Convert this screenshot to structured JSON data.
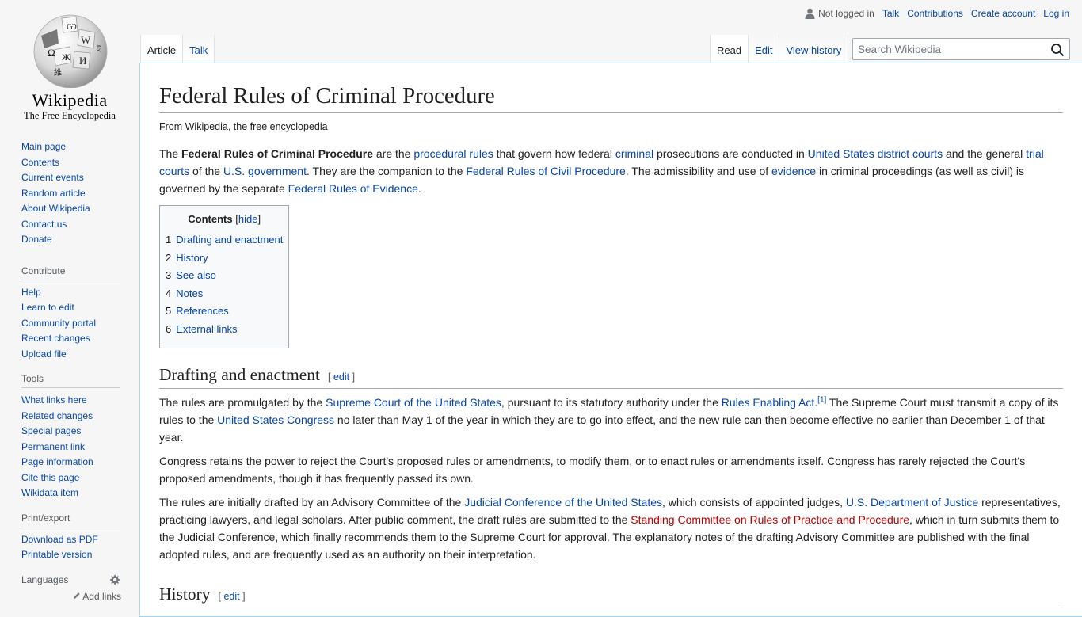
{
  "logo": {
    "wordmark": "Wikipedia",
    "tagline": "The Free Encyclopedia"
  },
  "personal": {
    "not_logged_in": "Not logged in",
    "talk": "Talk",
    "contributions": "Contributions",
    "create_account": "Create account",
    "log_in": "Log in"
  },
  "tabs": {
    "left": [
      "Article",
      "Talk"
    ],
    "right": [
      "Read",
      "Edit",
      "View history"
    ]
  },
  "search": {
    "placeholder": "Search Wikipedia",
    "icon": "search-icon"
  },
  "sidebar": {
    "navigation": [
      "Main page",
      "Contents",
      "Current events",
      "Random article",
      "About Wikipedia",
      "Contact us",
      "Donate"
    ],
    "contribute": {
      "heading": "Contribute",
      "items": [
        "Help",
        "Learn to edit",
        "Community portal",
        "Recent changes",
        "Upload file"
      ]
    },
    "tools": {
      "heading": "Tools",
      "items": [
        "What links here",
        "Related changes",
        "Special pages",
        "Permanent link",
        "Page information",
        "Cite this page",
        "Wikidata item"
      ]
    },
    "printexport": {
      "heading": "Print/export",
      "items": [
        "Download as PDF",
        "Printable version"
      ]
    },
    "languages": {
      "heading": "Languages",
      "add_links": "Add links"
    }
  },
  "article": {
    "title": "Federal Rules of Criminal Procedure",
    "site_sub": "From Wikipedia, the free encyclopedia",
    "intro": {
      "t1": "The ",
      "b1": "Federal Rules of Criminal Procedure",
      "t2": " are the ",
      "l1": "procedural rules",
      "t3": " that govern how federal ",
      "l2": "criminal",
      "t4": " prosecutions are conducted in ",
      "l3": "United States district courts",
      "t5": " and the general ",
      "l4": "trial courts",
      "t6": " of the ",
      "l5": "U.S. government",
      "t7": ". They are the companion to the ",
      "l6": "Federal Rules of Civil Procedure",
      "t8": ". The admissibility and use of ",
      "l7": "evidence",
      "t9": " in criminal proceedings (as well as civil) is governed by the separate ",
      "l8": "Federal Rules of Evidence",
      "t10": "."
    },
    "toc": {
      "title": "Contents",
      "hide": "hide",
      "items": [
        {
          "num": "1",
          "label": "Drafting and enactment"
        },
        {
          "num": "2",
          "label": "History"
        },
        {
          "num": "3",
          "label": "See also"
        },
        {
          "num": "4",
          "label": "Notes"
        },
        {
          "num": "5",
          "label": "References"
        },
        {
          "num": "6",
          "label": "External links"
        }
      ]
    },
    "drafting": {
      "heading": "Drafting and enactment",
      "edit": "edit",
      "p1": {
        "t1": "The rules are promulgated by the ",
        "l1": "Supreme Court of the United States",
        "t2": ", pursuant to its statutory authority under the ",
        "l2": "Rules Enabling Act",
        "t3": ".",
        "ref": "[1]",
        "t4": " The Supreme Court must transmit a copy of its rules to the ",
        "l3": "United States Congress",
        "t5": " no later than May 1 of the year in which they are to go into effect, and the new rule can then become effective no earlier than December 1 of that year."
      },
      "p2": "Congress retains the power to reject the Court's proposed rules or amendments, to modify them, or to enact rules or amendments itself. Congress has rarely rejected the Court's proposed amendments, though it has frequently passed its own.",
      "p3": {
        "t1": "The rules are initially drafted by an Advisory Committee of the ",
        "l1": "Judicial Conference of the United States",
        "t2": ", which consists of appointed judges, ",
        "l2": "U.S. Department of Justice",
        "t3": " representatives, practicing lawyers, and legal scholars. After public comment, the draft rules are submitted to the ",
        "l3": "Standing Committee on Rules of Practice and Procedure",
        "t4": ", which in turn submits them to the Judicial Conference, which finally recommends them to the Supreme Court for approval. The explanatory notes of the drafting Advisory Committee are published with the final adopted rules, and are frequently used as an authority on their interpretation."
      }
    },
    "history": {
      "heading": "History",
      "edit": "edit"
    }
  }
}
